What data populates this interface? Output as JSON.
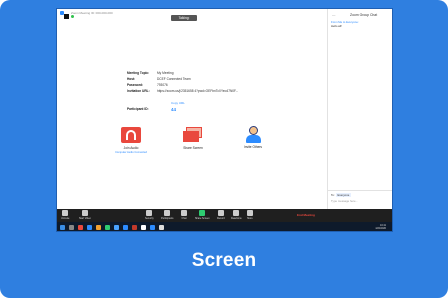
{
  "caption": "Screen",
  "window": {
    "title": "Zoom Meeting ID: 000-000-000",
    "talking_label": "Talking:"
  },
  "meeting": {
    "topic_label": "Meeting Topic:",
    "topic_value": "My Meeting",
    "host_label": "Host:",
    "host_value": "DCEF Connected Team",
    "password_label": "Password:",
    "password_value": "793076",
    "invite_label": "Invitation URL:",
    "invite_value": "https://zoom.us/j/2351658 4?pwd=OEFbnTcXYeo47N0F...",
    "copy_url": "Copy URL",
    "participants_label": "Participant ID:",
    "participants_value": "44"
  },
  "tiles": {
    "audio_label": "Join Audio",
    "audio_sub": "Computer Audio Connected",
    "share_label": "Share Screen",
    "invite_label": "Invite Others"
  },
  "chat": {
    "title": "Zoom Group Chat",
    "close": "—",
    "msg_from": "From Me to Everyone:",
    "msg_text": "Hello all!",
    "to_label": "To:",
    "to_value": "Everyone",
    "input_placeholder": "Type message here..."
  },
  "toolbar": {
    "mute": "Unmute",
    "video": "Start Video",
    "security": "Security",
    "participants": "Participants",
    "chat": "Chat",
    "share": "Share Screen",
    "record": "Record",
    "reactions": "Reactions",
    "more": "More",
    "end": "End Meeting"
  },
  "taskbar": {
    "time": "10:41",
    "date": "4/22/2020"
  },
  "colors": {
    "card": "#2f7fe0",
    "accent": "#2d8cff",
    "danger": "#e9483d"
  }
}
